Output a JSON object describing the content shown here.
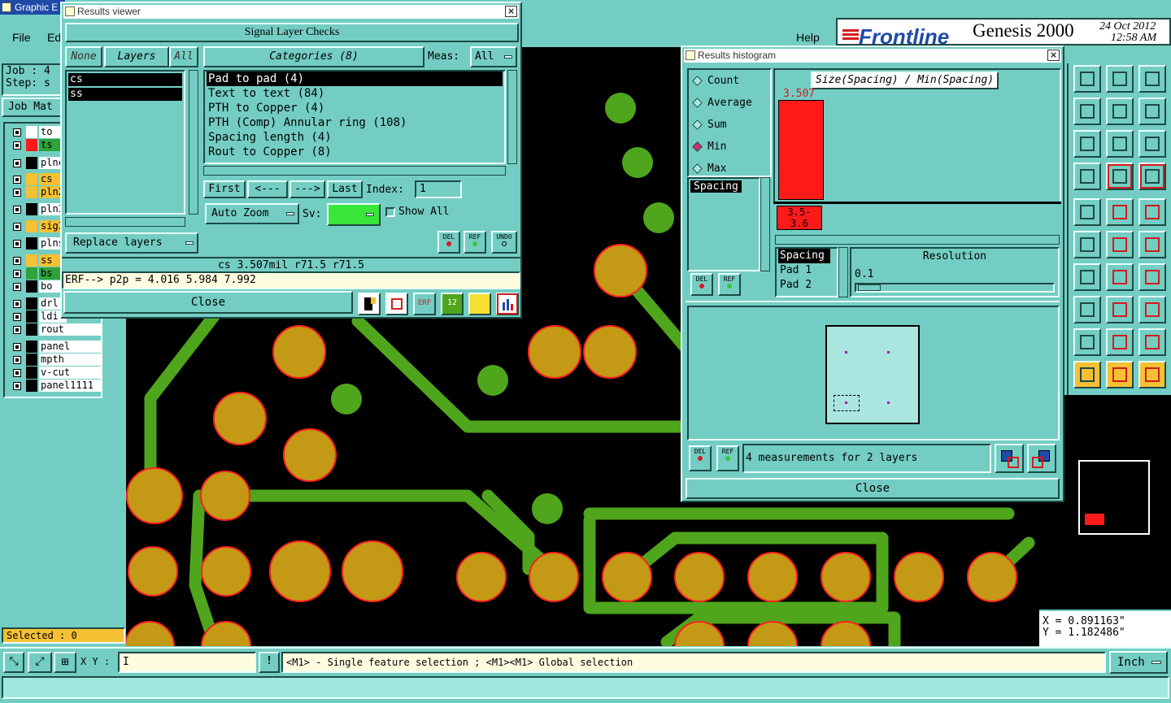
{
  "app": {
    "title": "Graphic E",
    "menu": {
      "file": "File",
      "edit": "Ed",
      "help": "Help"
    },
    "brand": {
      "logo": "Frontline",
      "product": "Genesis 2000",
      "date": "24 Oct 2012",
      "time": "12:58 AM"
    },
    "job": {
      "job_label": "Job  : 4",
      "step_label": "Step: s",
      "job_matrix": "Job Mat"
    },
    "layers": [
      {
        "name": "to",
        "color": "#ffffff"
      },
      {
        "name": "ts",
        "color": "#ff1a1a"
      },
      {
        "name": "plnc",
        "color": "#000000"
      },
      {
        "name": "cs",
        "color": "#f5c033"
      },
      {
        "name": "pln2",
        "color": "#f5c033"
      },
      {
        "name": "pln3",
        "color": "#000000"
      },
      {
        "name": "sig3",
        "color": "#f5c033"
      },
      {
        "name": "plns",
        "color": "#000000"
      },
      {
        "name": "ss",
        "color": "#f5c033"
      },
      {
        "name": "bs",
        "color": "#2fa33b"
      },
      {
        "name": "bo",
        "color": "#000000"
      },
      {
        "name": "drl",
        "color": "#000000"
      },
      {
        "name": "ldi",
        "color": "#000000"
      },
      {
        "name": "rout",
        "color": "#000000"
      },
      {
        "name": "panel",
        "color": "#000000"
      },
      {
        "name": "mpth",
        "color": "#000000"
      },
      {
        "name": "v-cut",
        "color": "#000000"
      },
      {
        "name": "panel1111",
        "color": "#000000"
      }
    ],
    "selected": "Selected : 0",
    "coords": {
      "x": "X = 0.891163\"",
      "y": "Y = 1.182486\""
    },
    "bottom": {
      "xy_label": "X Y :",
      "xy_value": "I",
      "hint": "<M1> - Single feature selection ; <M1><M1> Global selection",
      "units": "Inch"
    }
  },
  "results_viewer": {
    "title": "Results viewer",
    "header": "Signal Layer Checks",
    "none": "None",
    "layers": "Layers",
    "all": "All",
    "categories_label": "Categories (8)",
    "meas_label": "Meas:",
    "meas_value": "All",
    "layer_items": [
      "cs",
      "ss"
    ],
    "categories": [
      "Pad to pad (4)",
      "Text to text (84)",
      "PTH to Copper (4)",
      "PTH (Comp) Annular ring (108)",
      "Spacing length (4)",
      "Rout to Copper (8)"
    ],
    "nav": {
      "first": "First",
      "prev": "<---",
      "next": "--->",
      "last": "Last",
      "index_label": "Index:",
      "index_value": "1"
    },
    "auto_zoom": "Auto Zoom",
    "sv_label": "Sv:",
    "show_all": "Show All",
    "replace_layers": "Replace layers",
    "del": "DEL",
    "ref": "REF",
    "undo": "UNDO",
    "status": "cs 3.507mil  r71.5  r71.5",
    "erf": "ERF--> p2p = 4.016 5.984 7.992",
    "close": "Close"
  },
  "histogram": {
    "title": "Results histogram",
    "stats": [
      "Count",
      "Average",
      "Sum",
      "Min",
      "Max"
    ],
    "selected_stat": "Min",
    "list_item": "Spacing",
    "chart_title": "Size(Spacing) / Min(Spacing)",
    "bar_value": "3.507",
    "bin_label_1": "3.5-",
    "bin_label_2": "3.6",
    "bar_fraction": 0.88,
    "fields": [
      "Spacing",
      "Pad 1",
      "Pad 2"
    ],
    "resolution_label": "Resolution",
    "resolution_value": "0.1",
    "measurements": "4 measurements for 2 layers",
    "close": "Close",
    "del": "DEL",
    "ref": "REF"
  }
}
